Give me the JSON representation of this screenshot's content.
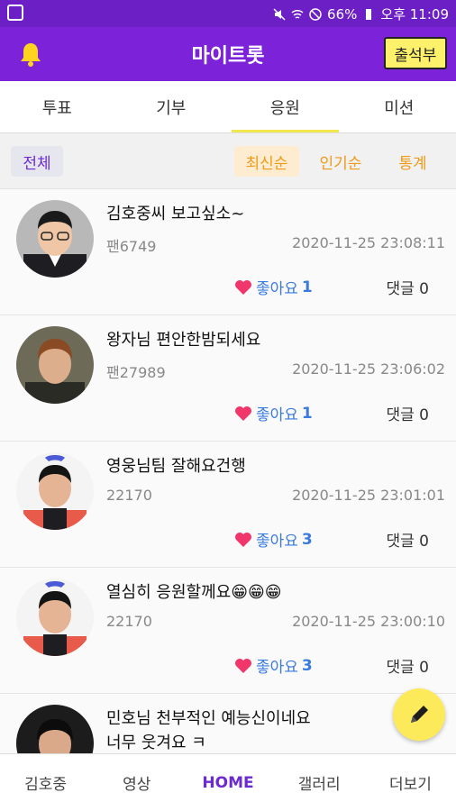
{
  "statusbar": {
    "battery": "66%",
    "time": "오후 11:09"
  },
  "appbar": {
    "title": "마이트롯",
    "attend_label": "출석부"
  },
  "tabs": [
    {
      "label": "투표",
      "active": false
    },
    {
      "label": "기부",
      "active": false
    },
    {
      "label": "응원",
      "active": true
    },
    {
      "label": "미션",
      "active": false
    }
  ],
  "filters": {
    "all_label": "전체",
    "latest_label": "최신순",
    "popular_label": "인기순",
    "stats_label": "통계"
  },
  "posts": [
    {
      "message": "김호중씨 보고싶소~",
      "author": "팬6749",
      "date": "2020-11-25 23:08:11",
      "like_label": "좋아요",
      "likes": "1",
      "comment_label": "댓글",
      "comments": "0",
      "avatar": "avatar-1"
    },
    {
      "message": "왕자님 편안한밤되세요",
      "author": "팬27989",
      "date": "2020-11-25 23:06:02",
      "like_label": "좋아요",
      "likes": "1",
      "comment_label": "댓글",
      "comments": "0",
      "avatar": "avatar-2"
    },
    {
      "message": "영웅님팀 잘해요건행",
      "author": "22170",
      "date": "2020-11-25 23:01:01",
      "like_label": "좋아요",
      "likes": "3",
      "comment_label": "댓글",
      "comments": "0",
      "avatar": "avatar-3"
    },
    {
      "message": "열심히 응원할께요😁😁😁",
      "author": "22170",
      "date": "2020-11-25 23:00:10",
      "like_label": "좋아요",
      "likes": "3",
      "comment_label": "댓글",
      "comments": "0",
      "avatar": "avatar-3"
    },
    {
      "message": "민호님 천부적인 예능신이네요\n너무 웃겨요 ㅋ",
      "author": "",
      "date": "",
      "like_label": "",
      "likes": "",
      "comment_label": "",
      "comments": "",
      "avatar": "avatar-4"
    }
  ],
  "bottomnav": [
    {
      "label": "김호중",
      "active": false
    },
    {
      "label": "영상",
      "active": false
    },
    {
      "label": "HOME",
      "active": true
    },
    {
      "label": "갤러리",
      "active": false
    },
    {
      "label": "더보기",
      "active": false
    }
  ],
  "colors": {
    "appbar": "#7c22d9",
    "statusbar": "#6c1fc4",
    "accent_yellow": "#fdea5a",
    "filter_orange": "#f09a1a",
    "like_blue": "#3b7be0"
  }
}
